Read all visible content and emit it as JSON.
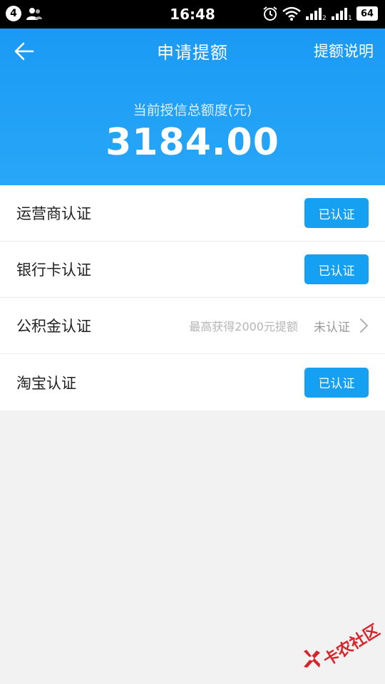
{
  "status_bar": {
    "notification_count": "4",
    "time": "16:48",
    "battery": "64"
  },
  "header": {
    "title": "申请提额",
    "help_link": "提额说明",
    "credit_label": "当前授信总额度(元)",
    "credit_amount": "3184.00"
  },
  "verifications": [
    {
      "label": "运营商认证",
      "status": "已认证"
    },
    {
      "label": "银行卡认证",
      "status": "已认证"
    },
    {
      "label": "公积金认证",
      "hint": "最高获得2000元提额",
      "status": "未认证"
    },
    {
      "label": "淘宝认证",
      "status": "已认证"
    }
  ],
  "watermark": {
    "text": "卡农社区"
  },
  "colors": {
    "header_blue": "#1a9af4",
    "button_blue": "#15a0f2",
    "watermark_red": "#d8232a"
  }
}
